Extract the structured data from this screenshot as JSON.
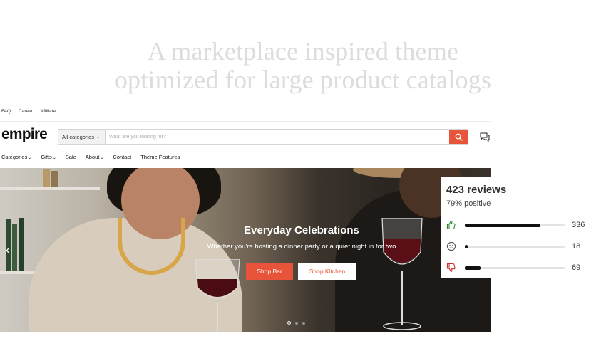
{
  "headline": {
    "line1": "A marketplace inspired theme",
    "line2": "optimized for large product catalogs"
  },
  "utility_links": [
    "FAQ",
    "Career",
    "Affiliate"
  ],
  "logo": "empire",
  "search": {
    "category_label": "All categories",
    "placeholder": "What are you looking for?"
  },
  "nav": {
    "categories": "Categories",
    "gifts": "Gifts",
    "sale": "Sale",
    "about": "About",
    "contact": "Contact",
    "theme_features": "Theme Features"
  },
  "hero": {
    "title": "Everyday Celebrations",
    "subtitle": "Whether you're hosting a dinner party or a quiet night in for two",
    "btn_primary": "Shop Bar",
    "btn_secondary": "Shop Kitchen",
    "slide_count": 3,
    "active_slide": 1
  },
  "reviews": {
    "total": "423 reviews",
    "positive": "79% positive",
    "rows": [
      {
        "icon": "thumbs-up-icon",
        "count": "336",
        "fraction": 0.76,
        "color": "#2e8b2e"
      },
      {
        "icon": "neutral-face-icon",
        "count": "18",
        "fraction": 0.03,
        "color": "#555555"
      },
      {
        "icon": "thumbs-down-icon",
        "count": "69",
        "fraction": 0.16,
        "color": "#d0312d"
      }
    ]
  },
  "colors": {
    "accent": "#e8543a",
    "headline": "#dcdcdc"
  }
}
